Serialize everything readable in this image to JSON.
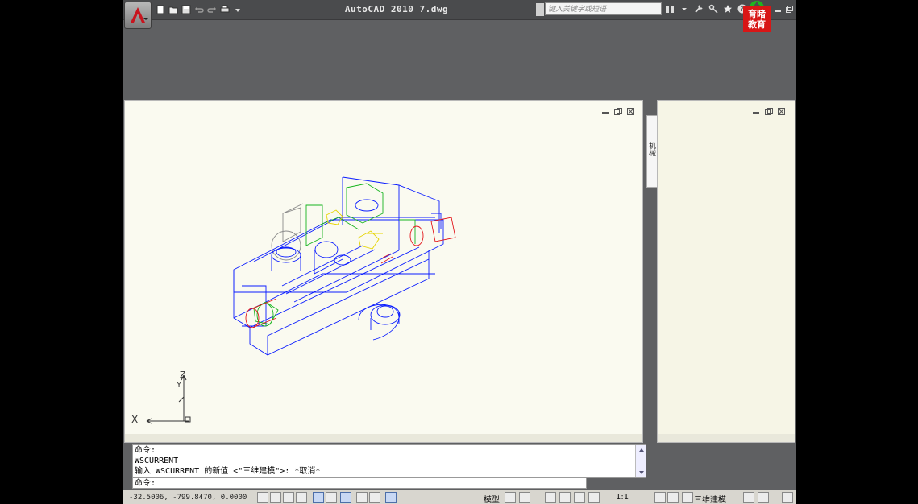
{
  "app": {
    "title": "AutoCAD 2010   7.dwg",
    "search_placeholder": "键入关键字或短语",
    "logo_text_line1": "育睹",
    "logo_text_line2": "教育"
  },
  "quick_access": {
    "icons": [
      "new-icon",
      "open-icon",
      "save-icon",
      "undo-icon",
      "redo-icon",
      "plot-icon",
      "dropdown-icon"
    ]
  },
  "infocenter": {
    "icons": [
      "binoculars-icon",
      "wrench-icon",
      "key-icon",
      "star-icon",
      "help-icon"
    ]
  },
  "drawing": {
    "ucs": {
      "x_label": "X",
      "y_label": "Y",
      "z_label": "Z"
    },
    "colors": {
      "blue": "#0a1cff",
      "green": "#17b41f",
      "red": "#e3181d",
      "yellow": "#e5d400",
      "gray": "#8a8a8a",
      "background": "#fafaf0"
    }
  },
  "palette": {
    "tab_label": "机械"
  },
  "command": {
    "history": [
      "命令:",
      "WSCURRENT",
      "输入 WSCURRENT 的新值 <\"三维建模\">: *取消*"
    ],
    "prompt": "命令:"
  },
  "status": {
    "coords": "-32.5006, -799.8470, 0.0000",
    "model_label": "模型",
    "scale_label": "1:1",
    "workspace_label": "三维建模"
  }
}
